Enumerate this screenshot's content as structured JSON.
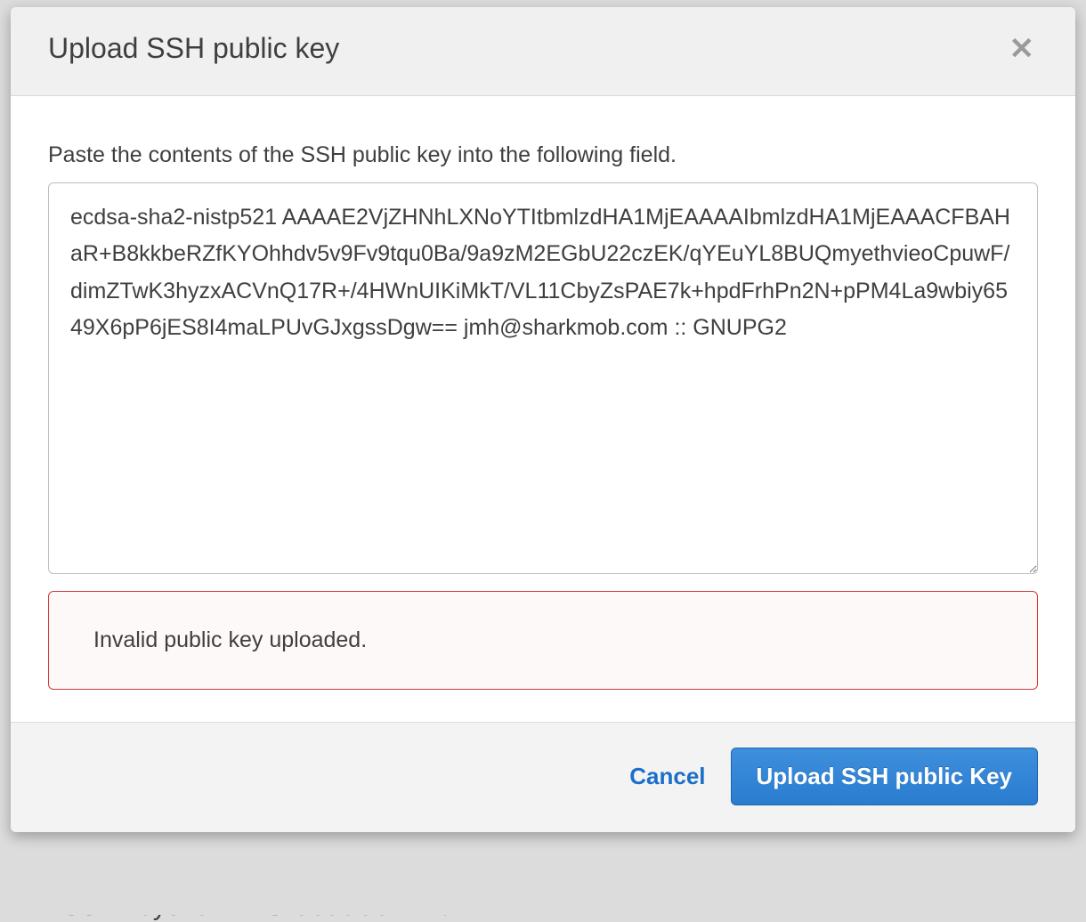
{
  "modal": {
    "title": "Upload SSH public key",
    "instruction": "Paste the contents of the SSH public key into the following field.",
    "textarea_value": "ecdsa-sha2-nistp521 AAAAE2VjZHNhLXNoYTItbmlzdHA1MjEAAAAIbmlzdHA1MjEAAACFBAHaR+B8kkbeRZfKYOhhdv5v9Fv9tqu0Ba/9a9zM2EGbU22czEK/qYEuYL8BUQmyethvieoCpuwF/dimZTwK3hyzxACVnQ17R+/4HWnUIKiMkT/VL11CbyZsPAE7k+hpdFrhPn2N+pPM4La9wbiy6549X6pP6jES8I4maLPUvGJxgssDgw== jmh@sharkmob.com :: GNUPG2",
    "error_message": "Invalid public key uploaded.",
    "cancel_label": "Cancel",
    "upload_label": "Upload SSH public Key"
  },
  "background": {
    "partial_text": "SSH keys for AWS CodeCommit"
  }
}
